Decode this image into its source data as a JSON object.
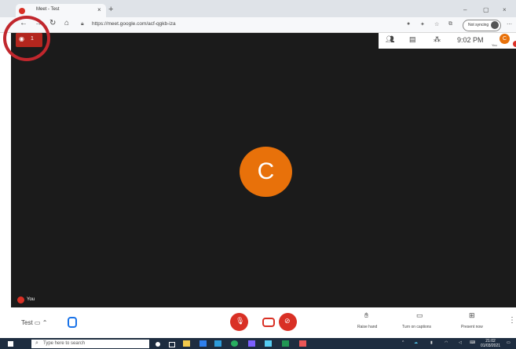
{
  "browser": {
    "tab_title": "Meet - Test",
    "tab_close": "×",
    "new_tab": "+",
    "url": "https://meet.google.com/acf-qgkb-iza",
    "sync_label": "Not syncing",
    "win_min": "–",
    "win_max": "▢",
    "win_close": "×"
  },
  "meet": {
    "viewer_count": "1",
    "time": "9:02 PM",
    "avatar_initial": "C",
    "self_initial": "C",
    "you_label": "You",
    "self_label": "You",
    "meeting_name": "Test",
    "actions": {
      "raise_hand": "Raise hand",
      "captions": "Turn on captions",
      "present": "Present now"
    }
  },
  "taskbar": {
    "search_placeholder": "Type here to search",
    "clock_time": "21:02",
    "clock_date": "01/03/2021"
  },
  "colors": {
    "accent_red": "#d93025",
    "avatar_orange": "#e8710a",
    "stage_bg": "#1b1b1b"
  }
}
